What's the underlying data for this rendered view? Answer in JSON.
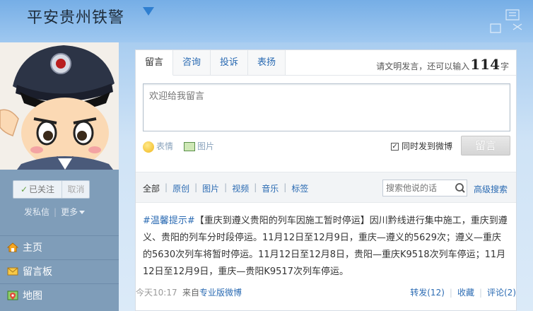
{
  "header": {
    "title": "平安贵州铁警"
  },
  "sidebar": {
    "follow_label": "已关注",
    "unfollow_label": "取消",
    "message_label": "发私信",
    "more_label": "更多",
    "nav": [
      {
        "label": "主页",
        "icon": "home-icon"
      },
      {
        "label": "留言板",
        "icon": "message-board-icon"
      },
      {
        "label": "地图",
        "icon": "map-icon"
      }
    ]
  },
  "composer": {
    "tabs": [
      "留言",
      "咨询",
      "投诉",
      "表扬"
    ],
    "active_tab": "留言",
    "remain_prefix": "请文明发言，还可以输入",
    "remain_count": "114",
    "remain_suffix": "字",
    "placeholder": "欢迎给我留言",
    "emote_label": "表情",
    "picture_label": "图片",
    "sync_label": "同时发到微博",
    "sync_checked": true,
    "submit_label": "留言"
  },
  "feed": {
    "filters": [
      "全部",
      "原创",
      "图片",
      "视频",
      "音乐",
      "标签"
    ],
    "search_placeholder": "搜索他说的话",
    "advanced_search": "高级搜索"
  },
  "post": {
    "tag": "#温馨提示#",
    "text": "【重庆到遵义贵阳的列车因施工暂时停运】因川黔线进行集中施工，重庆到遵义、贵阳的列车分时段停运。11月12日至12月9日，重庆—遵义的5629次；遵义—重庆的5630次列车将暂时停运。11月12日至12月8日，贵阳—重庆K9518次列车停运；11月12日至12月9日，重庆—贵阳K9517次列车停运。",
    "time": "今天10:17",
    "source_prefix": "来自",
    "source_link": "专业版微博",
    "repost": "转发(12)",
    "favorite": "收藏",
    "comment": "评论(2)"
  },
  "colors": {
    "link": "#2b6bb3",
    "sidebar": "#7f9db9",
    "header": "#76aee6"
  }
}
